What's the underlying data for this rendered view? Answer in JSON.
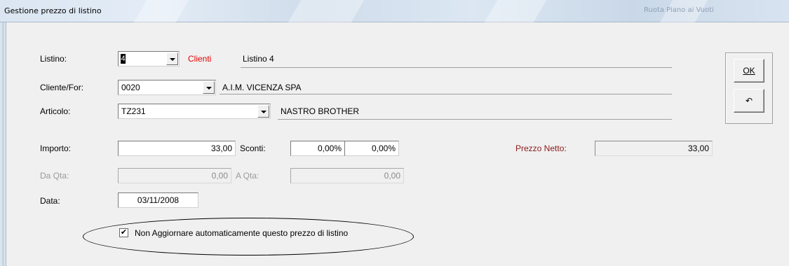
{
  "window": {
    "title": "Gestione prezzo di listino",
    "ghost_text": "Ruota Piano ai Vuoti"
  },
  "form": {
    "listino": {
      "label": "Listino:",
      "value": "4",
      "type_label": "Clienti",
      "description": "Listino 4"
    },
    "cliente": {
      "label": "Cliente/For:",
      "value": "0020",
      "description": "A.I.M. VICENZA SPA"
    },
    "articolo": {
      "label": "Articolo:",
      "value": "TZ231",
      "description": "NASTRO BROTHER"
    },
    "importo": {
      "label": "Importo:",
      "value": "33,00"
    },
    "sconti": {
      "label": "Sconti:",
      "value1": "0,00%",
      "value2": "0,00%"
    },
    "prezzo_netto": {
      "label": "Prezzo Netto:",
      "value": "33,00"
    },
    "da_qta": {
      "label": "Da Qta:",
      "value": "0,00"
    },
    "a_qta": {
      "label": "A Qta:",
      "value": "0,00"
    },
    "data": {
      "label": "Data:",
      "value": "03/11/2008"
    },
    "checkbox": {
      "label": "Non Aggiornare automaticamente questo prezzo di listino",
      "checked": true,
      "mark": "✔"
    }
  },
  "buttons": {
    "ok_label": "OK",
    "undo_icon": "undo-icon",
    "undo_glyph": "↶"
  },
  "colors": {
    "red": "#e00000",
    "maroon": "#8b1a1a"
  }
}
